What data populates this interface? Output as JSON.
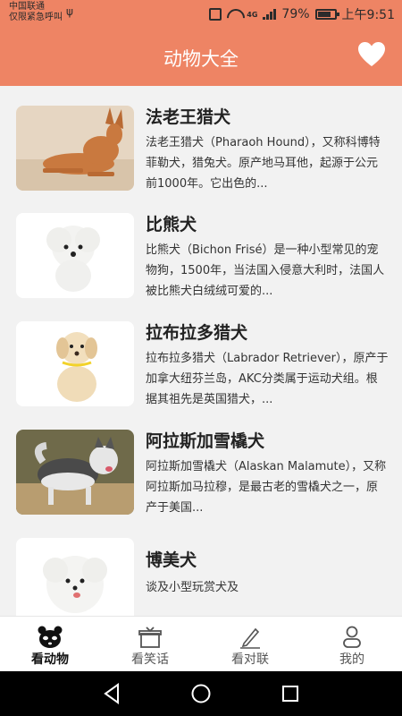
{
  "status": {
    "carrier_line1": "中国联通",
    "carrier_line2": "仅限紧急呼叫",
    "network": "4G",
    "battery": "79%",
    "time": "上午9:51"
  },
  "header": {
    "title": "动物大全"
  },
  "animals": [
    {
      "name": "法老王猎犬",
      "description": "法老王猎犬（Pharaoh Hound），又称科博特菲勒犬，猎兔犬。原产地马耳他，起源于公元前1000年。它出色的..."
    },
    {
      "name": "比熊犬",
      "description": "比熊犬（Bichon Frisé）是一种小型常见的宠物狗，1500年，当法国入侵意大利时，法国人被比熊犬白绒绒可爱的..."
    },
    {
      "name": "拉布拉多猎犬",
      "description": "拉布拉多猎犬（Labrador Retriever），原产于加拿大纽芬兰岛，AKC分类属于运动犬组。根据其祖先是英国猎犬，..."
    },
    {
      "name": "阿拉斯加雪橇犬",
      "description": "阿拉斯加雪橇犬（Alaskan Malamute），又称阿拉斯加马拉穆，是最古老的雪橇犬之一，原产于美国..."
    },
    {
      "name": "博美犬",
      "description": "谈及小型玩赏犬及"
    }
  ],
  "tabs": [
    {
      "label": "看动物",
      "icon": "panda-icon",
      "active": true
    },
    {
      "label": "看笑话",
      "icon": "gift-icon",
      "active": false
    },
    {
      "label": "看对联",
      "icon": "pen-icon",
      "active": false
    },
    {
      "label": "我的",
      "icon": "person-icon",
      "active": false
    }
  ],
  "colors": {
    "accent": "#ee8464",
    "background": "#f2f2f2"
  }
}
